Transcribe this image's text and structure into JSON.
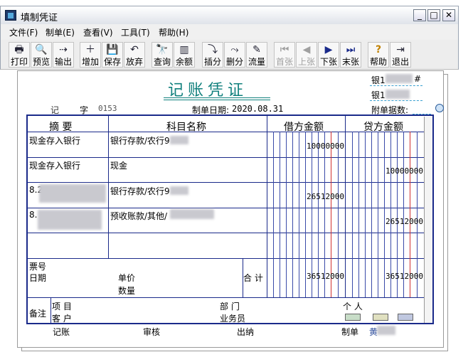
{
  "window": {
    "title": "填制凭证"
  },
  "menu": [
    "文件(F)",
    "制单(E)",
    "查看(V)",
    "工具(T)",
    "帮助(H)"
  ],
  "toolbar": [
    {
      "label": "打印",
      "icon": "🖶",
      "name": "print"
    },
    {
      "label": "预览",
      "icon": "🔍",
      "name": "preview"
    },
    {
      "label": "输出",
      "icon": "⇢",
      "name": "export"
    },
    {
      "label": "增加",
      "icon": "＋",
      "name": "add"
    },
    {
      "label": "保存",
      "icon": "💾",
      "name": "save"
    },
    {
      "label": "放弃",
      "icon": "↶",
      "name": "discard"
    },
    {
      "label": "查询",
      "icon": "🔭",
      "name": "query"
    },
    {
      "label": "余额",
      "icon": "▥",
      "name": "balance"
    },
    {
      "label": "插分",
      "icon": "⤵",
      "name": "insert-entry"
    },
    {
      "label": "删分",
      "icon": "⤳",
      "name": "delete-entry"
    },
    {
      "label": "流量",
      "icon": "✎",
      "name": "cash-flow"
    },
    {
      "label": "首张",
      "icon": "⏮",
      "name": "first"
    },
    {
      "label": "上张",
      "icon": "◀",
      "name": "prev"
    },
    {
      "label": "下张",
      "icon": "▶",
      "name": "next"
    },
    {
      "label": "末张",
      "icon": "⏭",
      "name": "last"
    },
    {
      "label": "帮助",
      "icon": "?",
      "name": "help"
    },
    {
      "label": "退出",
      "icon": "⇥",
      "name": "exit"
    }
  ],
  "voucher": {
    "title": "记账凭证",
    "bank1": "银1",
    "bank1_suffix": "#",
    "bank2": "银1",
    "type": "记",
    "zi": "字",
    "number": "0153",
    "date_label": "制单日期:",
    "date": "2020.08.31",
    "attach_label": "附单据数:",
    "headers": {
      "summary": "摘 要",
      "account": "科目名称",
      "debit": "借方金额",
      "credit": "贷方金额"
    },
    "rows": [
      {
        "summary": "现金存入银行",
        "account": "银行存款/农行9",
        "debit": "10000000",
        "credit": ""
      },
      {
        "summary": "现金存入银行",
        "account": "现金",
        "debit": "",
        "credit": "10000000"
      },
      {
        "summary": "8.2",
        "account": "银行存款/农行9",
        "debit": "26512000",
        "credit": ""
      },
      {
        "summary": "8.",
        "account": "预收账款/其他/",
        "debit": "",
        "credit": "26512000"
      },
      {
        "summary": "",
        "account": "",
        "debit": "",
        "credit": ""
      }
    ],
    "footer_labels": {
      "ticket": "票号",
      "date": "日期",
      "price": "单价",
      "qty": "数量",
      "total": "合 计"
    },
    "total_debit": "36512000",
    "total_credit": "36512000",
    "notes": {
      "label": "备注",
      "project": "项  目",
      "customer": "客  户",
      "dept": "部  门",
      "salesman": "业务员",
      "person": "个  人"
    },
    "signoffs": {
      "bookkeep": "记账",
      "audit": "审核",
      "cashier": "出纳",
      "maker": "制单",
      "maker_name": "黄"
    }
  }
}
